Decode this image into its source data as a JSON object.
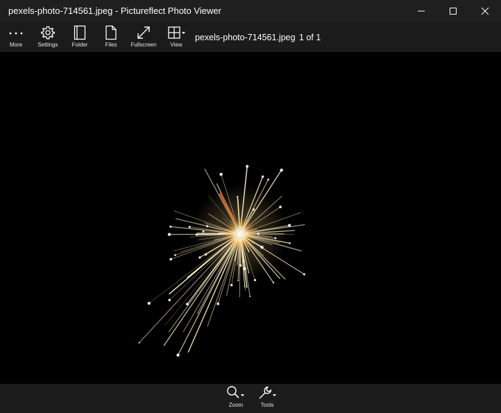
{
  "window": {
    "title": "pexels-photo-714561.jpeg - Pictureflect Photo Viewer"
  },
  "toolbar": {
    "more": "More",
    "settings": "Settings",
    "folder": "Folder",
    "files": "Files",
    "fullscreen": "Fullscreen",
    "view": "View",
    "filename": "pexels-photo-714561.jpeg",
    "counter": "1 of 1"
  },
  "bottombar": {
    "zoom": "Zoom",
    "tools": "Tools"
  },
  "image": {
    "subject": "sparkler",
    "background_color": "#000000",
    "spark_color": "#fff1c8",
    "core_color": "#ffb347"
  }
}
